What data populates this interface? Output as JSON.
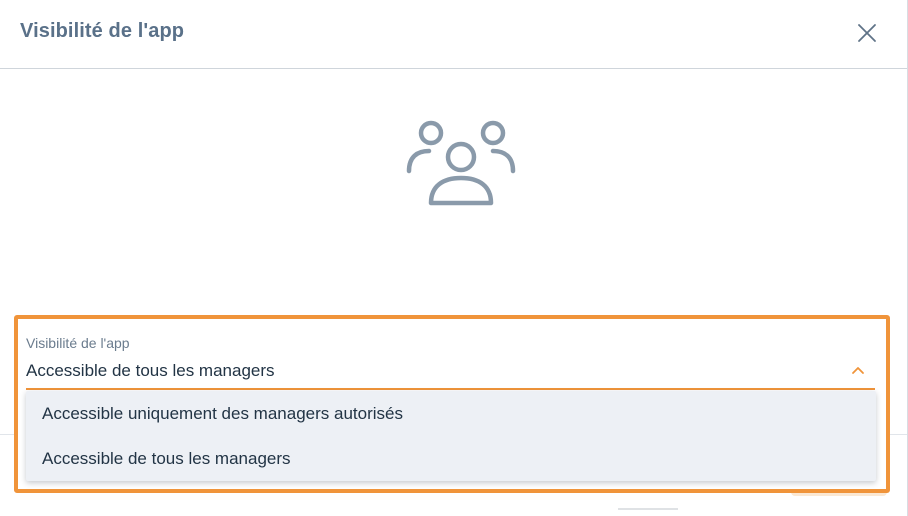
{
  "dialog": {
    "title": "Visibilité de l'app",
    "close_icon": "close-icon",
    "illustration_icon": "users-group-icon"
  },
  "visibility_select": {
    "label": "Visibilité de l'app",
    "selected_value": "Accessible de tous les managers",
    "expanded": true,
    "toggle_icon": "chevron-up-icon",
    "options": [
      {
        "label": "Accessible uniquement des managers autorisés"
      },
      {
        "label": "Accessible de tous les managers"
      }
    ]
  },
  "colors": {
    "title": "#5a7189",
    "accent": "#f0943a",
    "icon": "#8a9aaa",
    "dropdown_bg": "#edf0f5",
    "text": "#223445"
  }
}
